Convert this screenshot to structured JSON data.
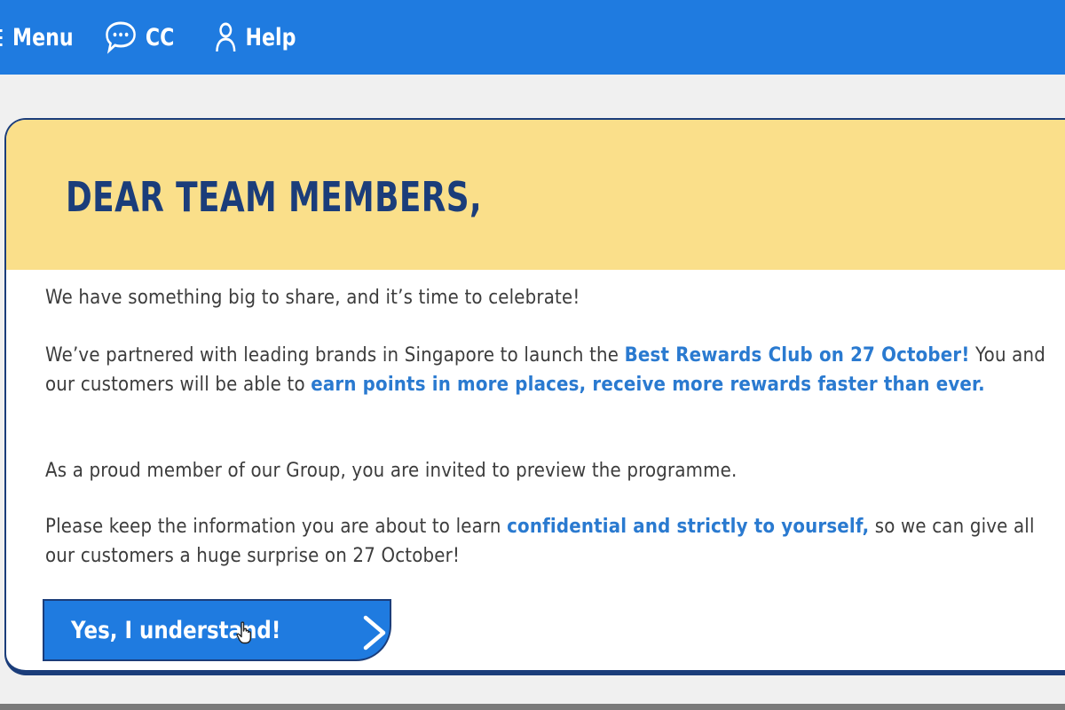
{
  "nav": {
    "menu_label": "Menu",
    "cc_label": "CC",
    "help_label": "Help"
  },
  "card": {
    "title": "DEAR TEAM MEMBERS,",
    "p1": "We have something big to share, and it’s time to celebrate!",
    "p2_a": "We’ve partnered with leading brands in Singapore to launch the ",
    "p2_hl1": "Best Rewards Club on 27 October!",
    "p2_b": " You and our customers will be able to ",
    "p2_hl2": "earn points in more places, receive more rewards faster than ever.",
    "p3": "As a proud member of our Group, you are invited to preview the programme.",
    "p4_a": "Please keep the information you are about to learn ",
    "p4_hl": "confidential and strictly to yourself,",
    "p4_b": " so we can give all our customers a huge surprise on 27 October!"
  },
  "cta": {
    "label": "Yes, I understand!"
  },
  "colors": {
    "topbar": "#1f7be0",
    "header_bg": "#fadf8a",
    "title": "#1b3d7a",
    "highlight": "#2a7ad0"
  },
  "icons": [
    "menu-icon",
    "chat-bubble-icon",
    "user-icon",
    "chevron-right-icon",
    "hand-cursor-icon"
  ]
}
